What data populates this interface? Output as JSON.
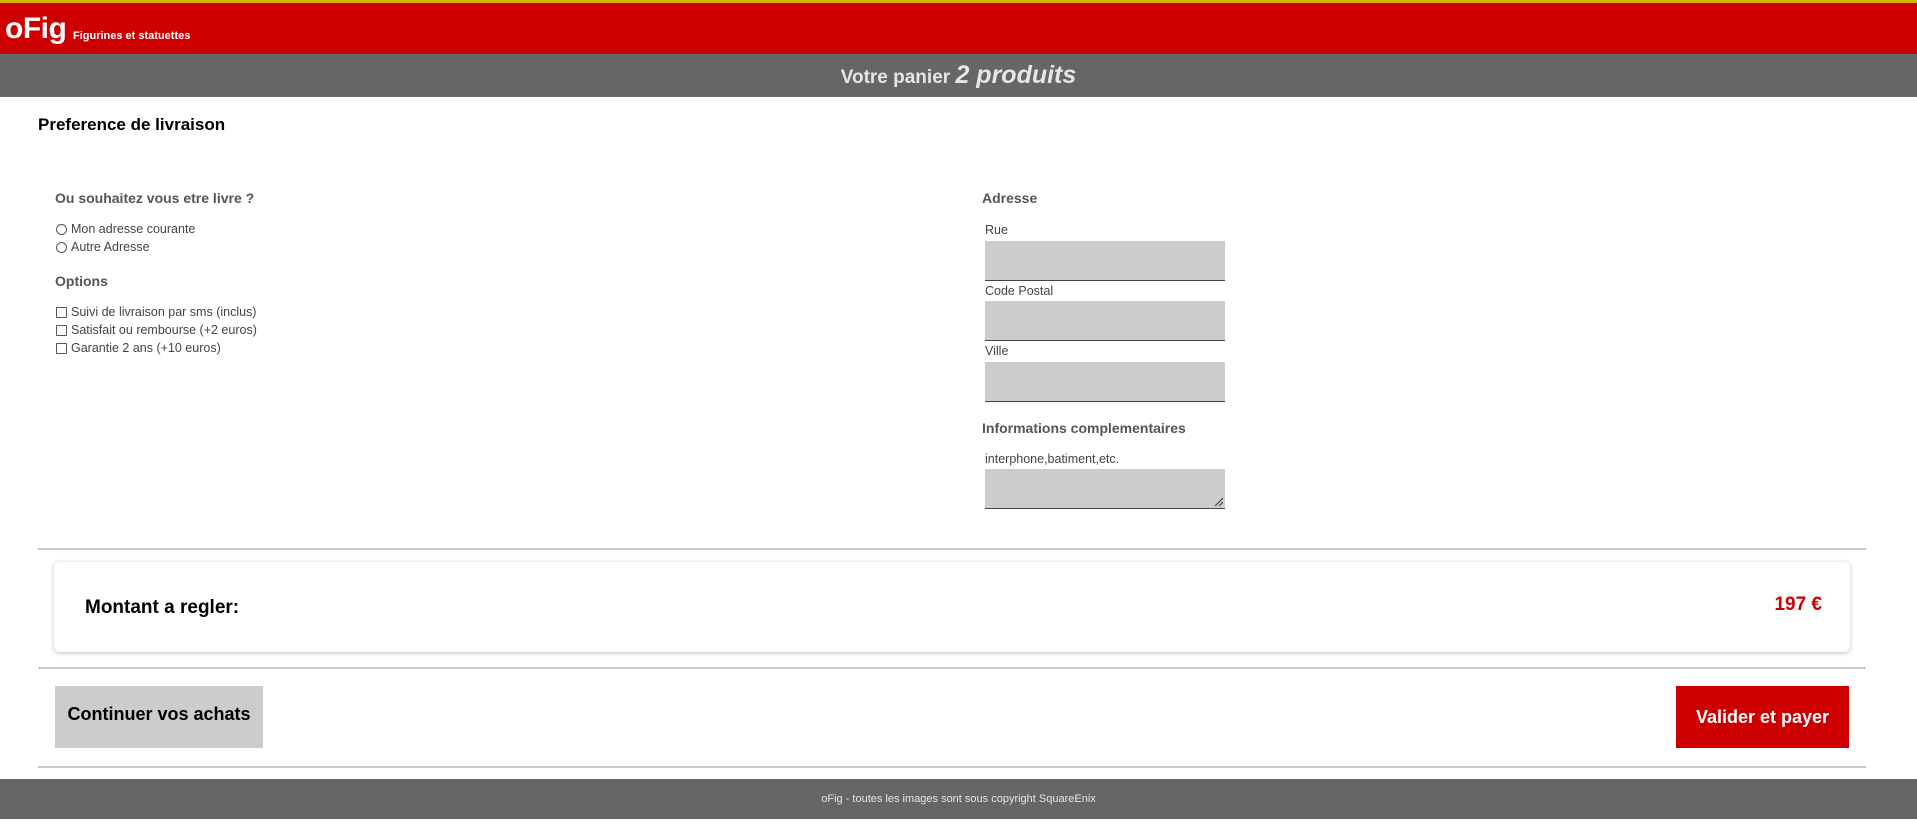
{
  "header": {
    "logo": "oFig",
    "tagline": "Figurines et statuettes"
  },
  "cart": {
    "prefix": "Votre panier",
    "count": "2 produits"
  },
  "delivery": {
    "title": "Preference de livraison",
    "where_label": "Ou souhaitez vous etre livre ?",
    "address_options": [
      "Mon adresse courante",
      "Autre Adresse"
    ],
    "options_label": "Options",
    "options": [
      "Suivi de livraison par sms (inclus)",
      "Satisfait ou rembourse (+2 euros)",
      "Garantie 2 ans (+10 euros)"
    ]
  },
  "address": {
    "title": "Adresse",
    "street_label": "Rue",
    "postal_label": "Code Postal",
    "city_label": "Ville",
    "extra_title": "Informations complementaires",
    "extra_label": "interphone,batiment,etc."
  },
  "total": {
    "label": "Montant a regler:",
    "value": "197 €"
  },
  "actions": {
    "continue_label": "Continuer vos achats",
    "pay_label": "Valider et payer"
  },
  "footer": {
    "text": "oFig - toutes les images sont sous copyright SquareEnix"
  },
  "colors": {
    "brand_red": "#cc0000",
    "header_top_stripe": "#d4b400",
    "bar_grey": "#666666",
    "input_grey": "#cccccc"
  }
}
